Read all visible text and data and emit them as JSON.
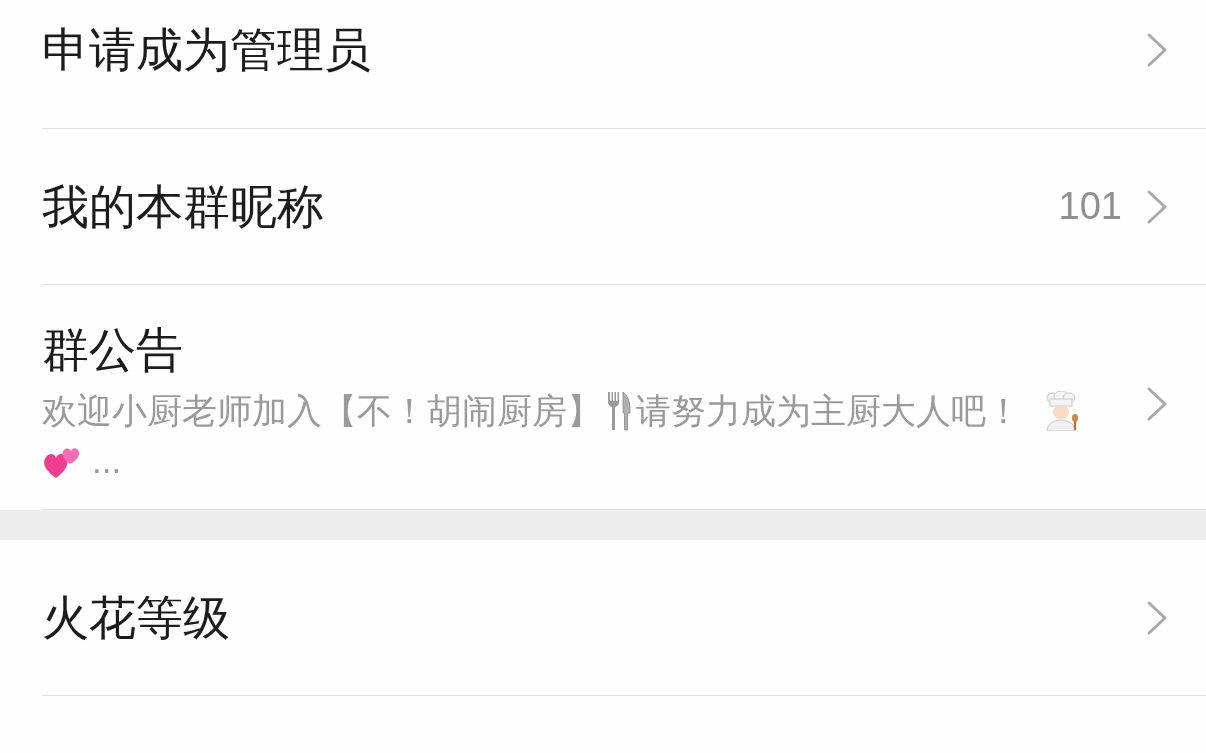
{
  "sections": [
    {
      "rows": [
        {
          "kind": "plain",
          "title": "申请成为管理员"
        },
        {
          "kind": "value",
          "title": "我的本群昵称",
          "value": "101"
        },
        {
          "kind": "announcement",
          "title": "群公告",
          "preview_lines": [
            [
              {
                "kind": "text",
                "text": "欢迎小厨老师加入【不！胡闹厨房】"
              },
              {
                "kind": "fork_knife"
              },
              {
                "kind": "text",
                "text": "请努力成为主厨大人吧！"
              },
              {
                "kind": "chef"
              }
            ],
            [
              {
                "kind": "hearts"
              },
              {
                "kind": "text",
                "text": "..."
              }
            ]
          ]
        }
      ]
    },
    {
      "rows": [
        {
          "kind": "plain",
          "title": "火花等级"
        }
      ]
    }
  ]
}
